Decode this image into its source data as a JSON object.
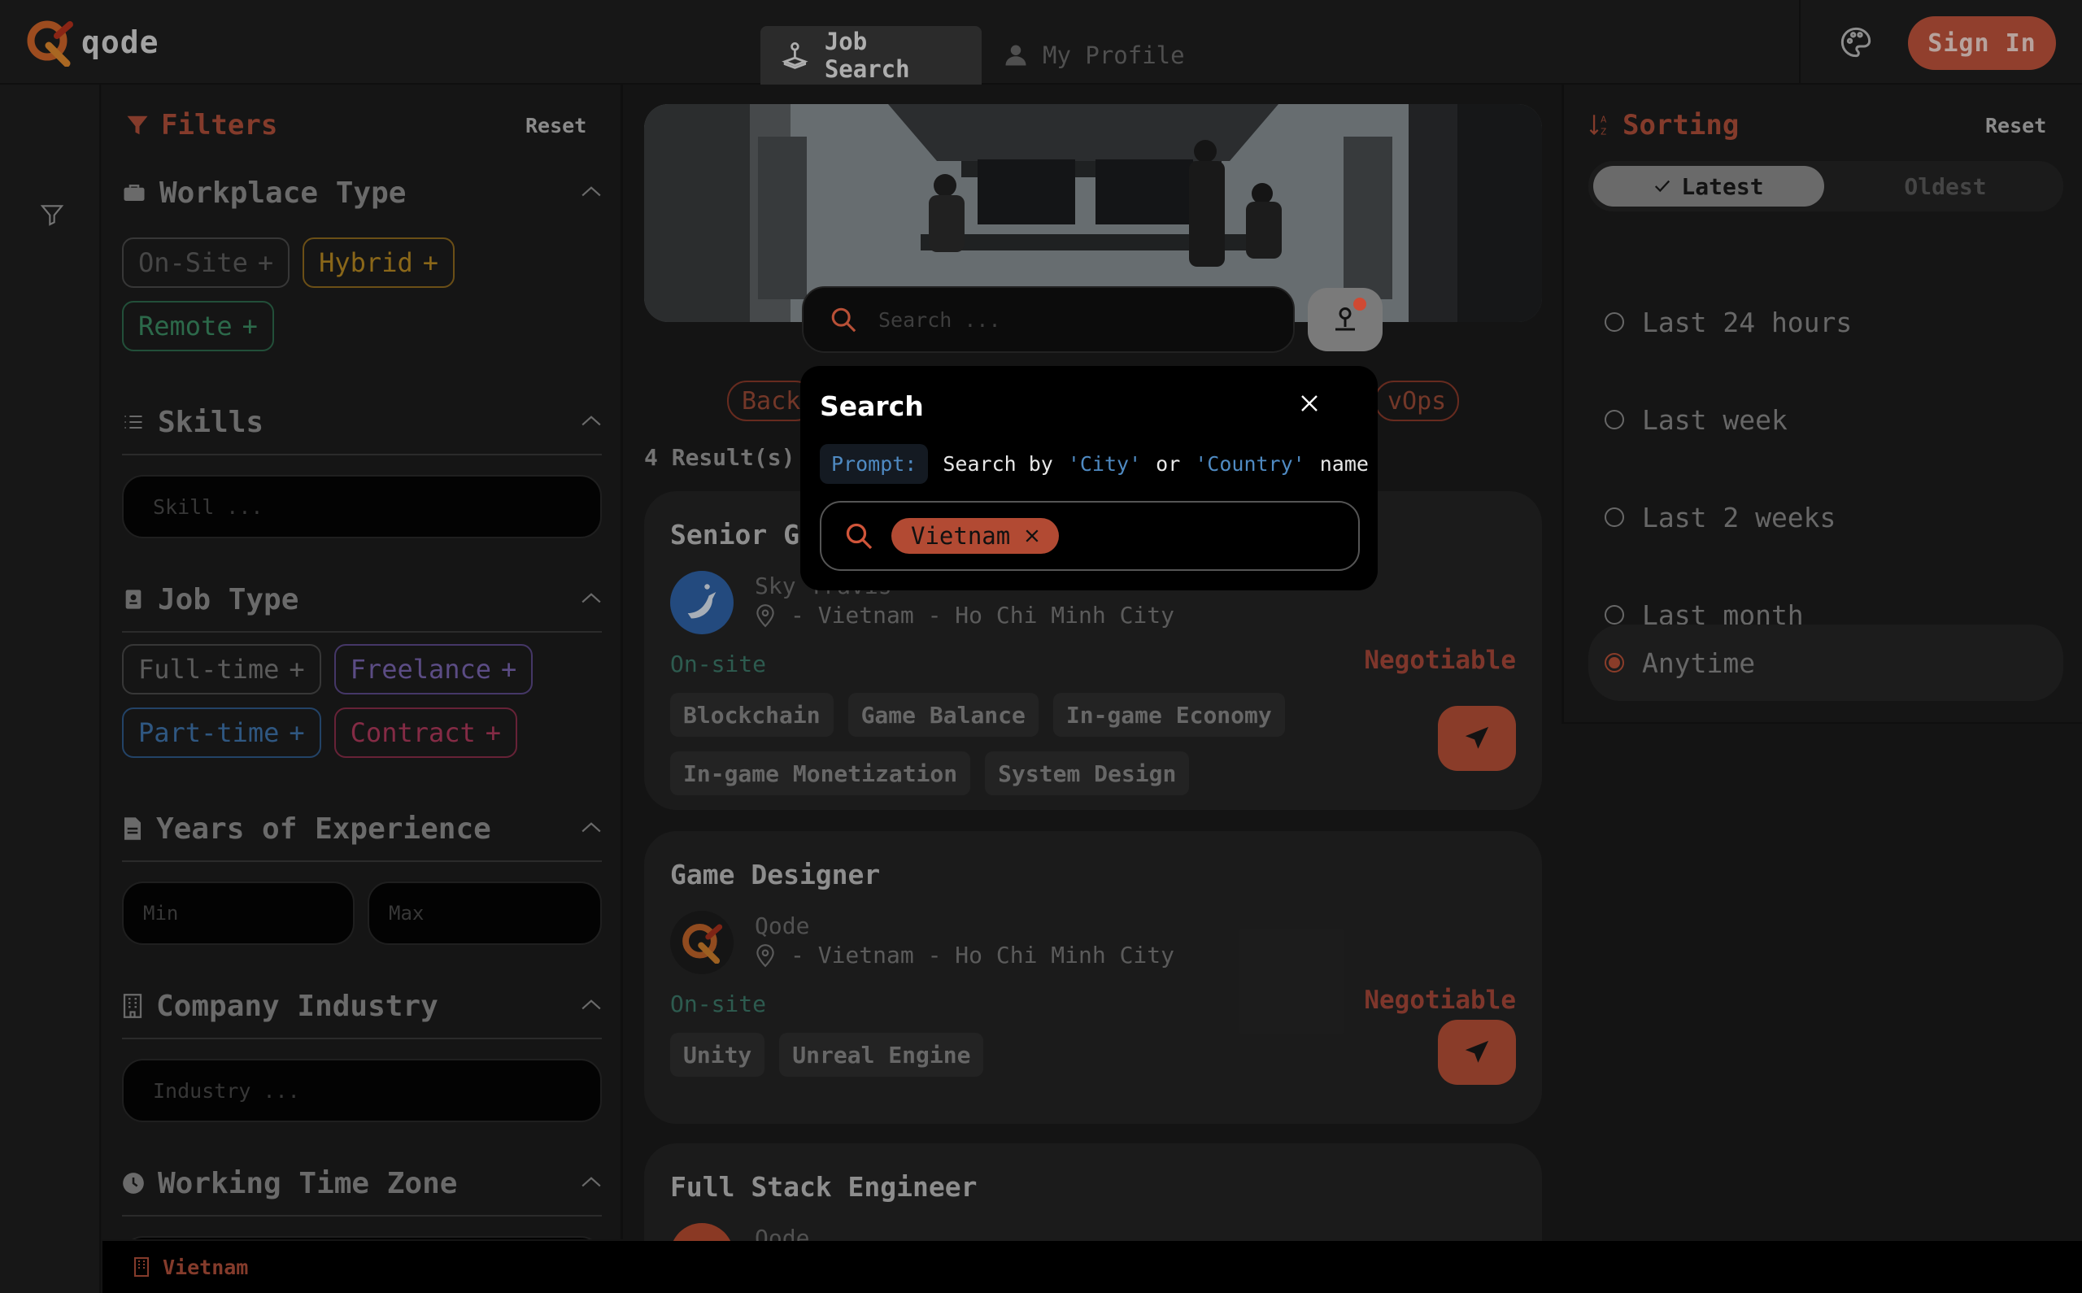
{
  "header": {
    "logo_text": "qode",
    "tabs": [
      {
        "label": "Job Search",
        "active": true
      },
      {
        "label": "My Profile",
        "active": false
      }
    ],
    "signin_label": "Sign In",
    "accent_color": "#c2553c"
  },
  "filters": {
    "title": "Filters",
    "reset_label": "Reset",
    "workplace": {
      "title": "Workplace Type",
      "options": [
        "On-Site",
        "Hybrid",
        "Remote"
      ]
    },
    "skills": {
      "title": "Skills",
      "placeholder": "Skill ..."
    },
    "job_type": {
      "title": "Job Type",
      "options": [
        "Full-time",
        "Freelance",
        "Part-time",
        "Contract"
      ]
    },
    "experience": {
      "title": "Years of Experience",
      "min_placeholder": "Min",
      "max_placeholder": "Max"
    },
    "industry": {
      "title": "Company Industry",
      "placeholder": "Industry ..."
    },
    "timezone": {
      "title": "Working Time Zone"
    }
  },
  "search": {
    "placeholder": "Search ...",
    "category_left": "Back",
    "category_right": "vOps"
  },
  "results": {
    "count_label": "4 Result(s)",
    "jobs": [
      {
        "title": "Senior Ga",
        "company": "Sky Travis",
        "location": "- Vietnam - Ho Chi Minh City",
        "workplace": "On-site",
        "salary": "Negotiable",
        "skills": [
          "Blockchain",
          "Game Balance",
          "In-game Economy",
          "In-game Monetization",
          "System Design"
        ]
      },
      {
        "title": "Game Designer",
        "company": "Qode",
        "location": "- Vietnam - Ho Chi Minh City",
        "workplace": "On-site",
        "salary": "Negotiable",
        "skills": [
          "Unity",
          "Unreal Engine"
        ]
      },
      {
        "title": "Full Stack Engineer",
        "company": "Qode"
      }
    ]
  },
  "modal": {
    "title": "Search",
    "prompt_badge": "Prompt:",
    "prompt_prefix": "Search by",
    "prompt_city": "'City'",
    "prompt_or": "or",
    "prompt_country": "'Country'",
    "prompt_suffix": "name",
    "tag": "Vietnam"
  },
  "sorting": {
    "title": "Sorting",
    "reset_label": "Reset",
    "order": {
      "latest": "Latest",
      "oldest": "Oldest",
      "selected": "Latest"
    },
    "periods": [
      "Last 24 hours",
      "Last week",
      "Last 2 weeks",
      "Last month",
      "Anytime"
    ],
    "selected_period": "Anytime"
  },
  "footer": {
    "location_label": "Vietnam"
  }
}
